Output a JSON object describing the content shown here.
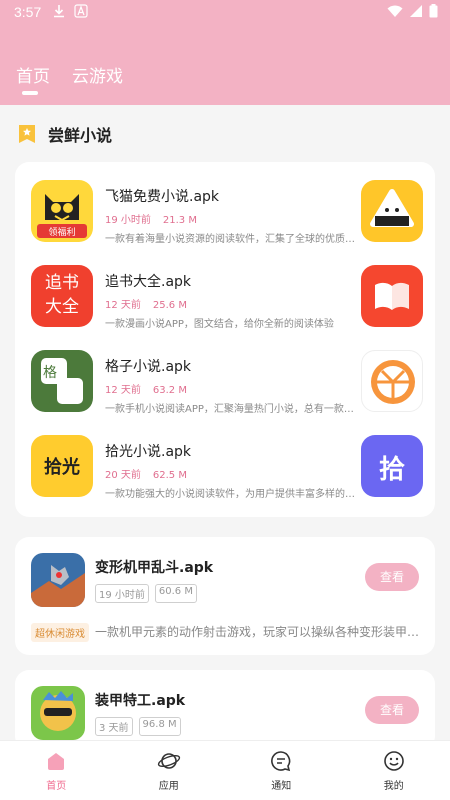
{
  "status": {
    "time": "3:57"
  },
  "colors": {
    "brand": "#f3b2c4",
    "accent": "#f06a8e",
    "meta": "#e06f8f"
  },
  "tabs": [
    "首页",
    "云游戏"
  ],
  "section": {
    "title": "尝鲜小说"
  },
  "novels": [
    {
      "name": "飞猫免费小说.apk",
      "time": "19 小时前",
      "size": "21.3 M",
      "desc": "一款有着海量小说资源的阅读软件，汇集了全球的优质小说",
      "icon": "cat-icon",
      "badge": "领福利"
    },
    {
      "name": "追书大全.apk",
      "time": "12 天前",
      "size": "25.6 M",
      "desc": "一款漫画小说APP，图文结合，给你全新的阅读体验",
      "icon": "zhuishu-icon",
      "badge": "追书 大全"
    },
    {
      "name": "格子小说.apk",
      "time": "12 天前",
      "size": "63.2 M",
      "desc": "一款手机小说阅读APP，汇聚海量热门小说，总有一款适合你",
      "icon": "gezi-icon",
      "badge": "格 子"
    },
    {
      "name": "拾光小说.apk",
      "time": "20 天前",
      "size": "62.5 M",
      "desc": "一款功能强大的小说阅读软件，为用户提供丰富多样的小说",
      "icon": "shiguang-icon",
      "badge": "拾光"
    }
  ],
  "side_icons": [
    "rice-ball-icon",
    "open-book-icon",
    "orange-slice-icon",
    "shi-logo-icon"
  ],
  "side_badge": "拾",
  "games": [
    {
      "name": "变形机甲乱斗.apk",
      "tags": [
        "19 小时前",
        "60.6 M"
      ],
      "button": "查看",
      "category": "超休闲游戏",
      "desc": "一款机甲元素的动作射击游戏，玩家可以操纵各种变形装甲进行战斗"
    },
    {
      "name": "装甲特工.apk",
      "tags": [
        "3 天前",
        "96.8 M"
      ],
      "button": "查看"
    }
  ],
  "nav": [
    {
      "label": "首页",
      "icon": "home-icon"
    },
    {
      "label": "应用",
      "icon": "planet-icon"
    },
    {
      "label": "通知",
      "icon": "chat-icon"
    },
    {
      "label": "我的",
      "icon": "smile-icon"
    }
  ]
}
